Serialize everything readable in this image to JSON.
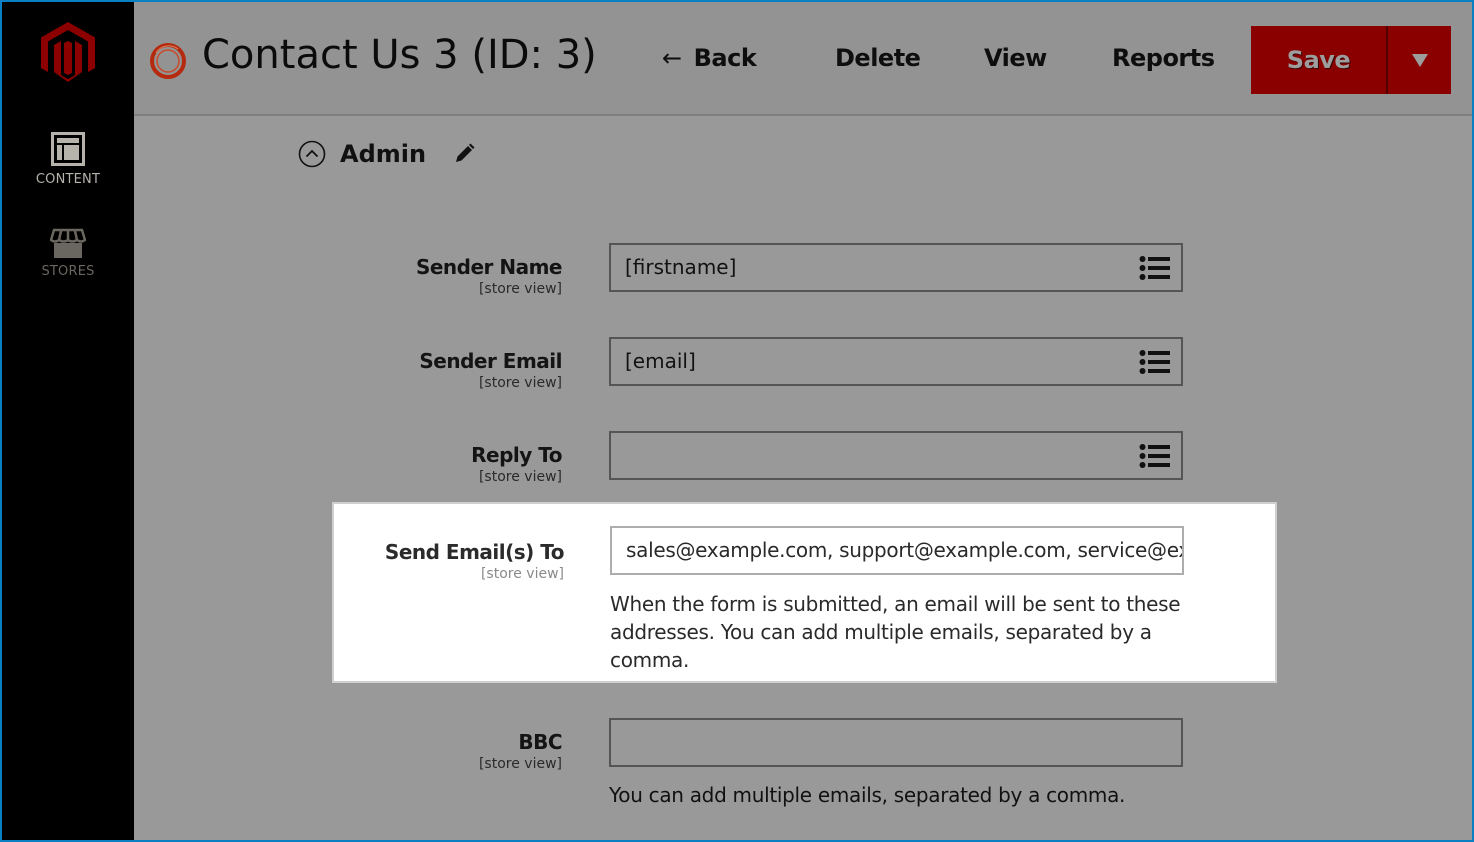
{
  "sidebar": {
    "logo": "magento-logo",
    "items": [
      {
        "label": "CONTENT",
        "icon": "layout-icon",
        "active": true
      },
      {
        "label": "STORES",
        "icon": "storefront-icon",
        "active": false
      }
    ]
  },
  "header": {
    "title": "Contact Us 3 (ID: 3)",
    "title_icon": "form-ring-icon",
    "back_arrow": "←",
    "back_label": "Back",
    "delete_label": "Delete",
    "view_label": "View",
    "reports_label": "Reports",
    "save_label": "Save",
    "colors": {
      "save_bg": "#8a0000",
      "accent": "#c0200e"
    }
  },
  "section": {
    "title": "Admin",
    "collapse_icon": "chevron-up-circle-icon",
    "edit_icon": "pencil-icon"
  },
  "fields": [
    {
      "label": "Sender Name",
      "scope": "[store view]",
      "value": "[firstname]",
      "has_variable_picker": true
    },
    {
      "label": "Sender Email",
      "scope": "[store view]",
      "value": "[email]",
      "has_variable_picker": true
    },
    {
      "label": "Reply To",
      "scope": "[store view]",
      "value": "",
      "has_variable_picker": true
    },
    {
      "label": "Send Email(s) To",
      "scope": "[store view]",
      "value": "sales@example.com, support@example.com, service@example.com",
      "note": "When the form is submitted, an email will be sent to these addresses. You can add multiple emails, separated by a comma.",
      "highlighted": true
    },
    {
      "label": "BBC",
      "scope": "[store view]",
      "value": "",
      "note": "You can add multiple emails, separated by a comma."
    }
  ]
}
